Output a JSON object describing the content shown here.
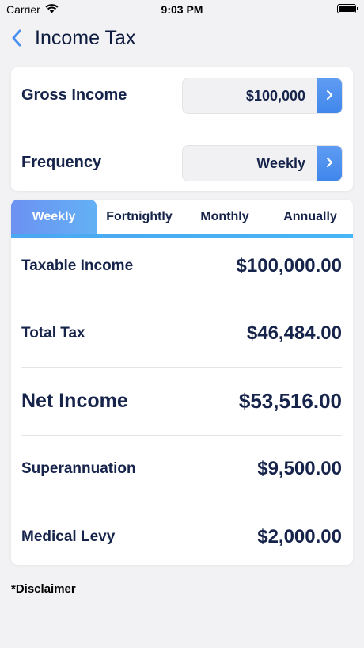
{
  "status_bar": {
    "carrier": "Carrier",
    "time": "9:03 PM"
  },
  "nav": {
    "title": "Income Tax"
  },
  "inputs": {
    "gross_income": {
      "label": "Gross Income",
      "value": "$100,000"
    },
    "frequency": {
      "label": "Frequency",
      "value": "Weekly"
    }
  },
  "tabs": [
    {
      "label": "Weekly",
      "active": true
    },
    {
      "label": "Fortnightly",
      "active": false
    },
    {
      "label": "Monthly",
      "active": false
    },
    {
      "label": "Annually",
      "active": false
    }
  ],
  "results": {
    "taxable_income": {
      "label": "Taxable Income",
      "value": "$100,000.00"
    },
    "total_tax": {
      "label": "Total Tax",
      "value": "$46,484.00"
    },
    "net_income": {
      "label": "Net Income",
      "value": "$53,516.00"
    },
    "superannuation": {
      "label": "Superannuation",
      "value": "$9,500.00"
    },
    "medical_levy": {
      "label": "Medical Levy",
      "value": "$2,000.00"
    }
  },
  "footer": {
    "disclaimer": "*Disclaimer"
  },
  "colors": {
    "accent": "#4a8ff0",
    "text": "#16234a",
    "background": "#f2f2f4"
  }
}
